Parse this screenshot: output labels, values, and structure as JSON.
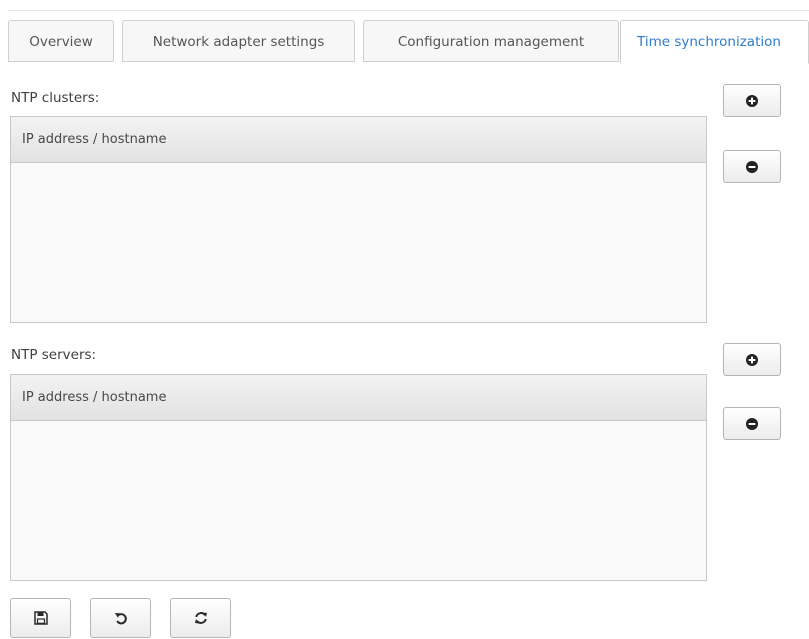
{
  "tabs": [
    {
      "label": "Overview",
      "active": false
    },
    {
      "label": "Network adapter settings",
      "active": false
    },
    {
      "label": "Configuration management",
      "active": false
    },
    {
      "label": "Time synchronization",
      "active": true
    }
  ],
  "ntp_clusters": {
    "label": "NTP clusters:",
    "column_header": "IP address / hostname",
    "rows": [],
    "add_icon": "plus-circle-icon",
    "remove_icon": "minus-circle-icon"
  },
  "ntp_servers": {
    "label": "NTP servers:",
    "column_header": "IP address / hostname",
    "rows": [],
    "add_icon": "plus-circle-icon",
    "remove_icon": "minus-circle-icon"
  },
  "bottom_toolbar": {
    "save_icon": "floppy-disk-icon",
    "undo_icon": "undo-icon",
    "refresh_icon": "refresh-icon"
  },
  "colors": {
    "active_tab_text": "#2f7cc9",
    "border": "#c8c8c8",
    "text": "#444444"
  }
}
